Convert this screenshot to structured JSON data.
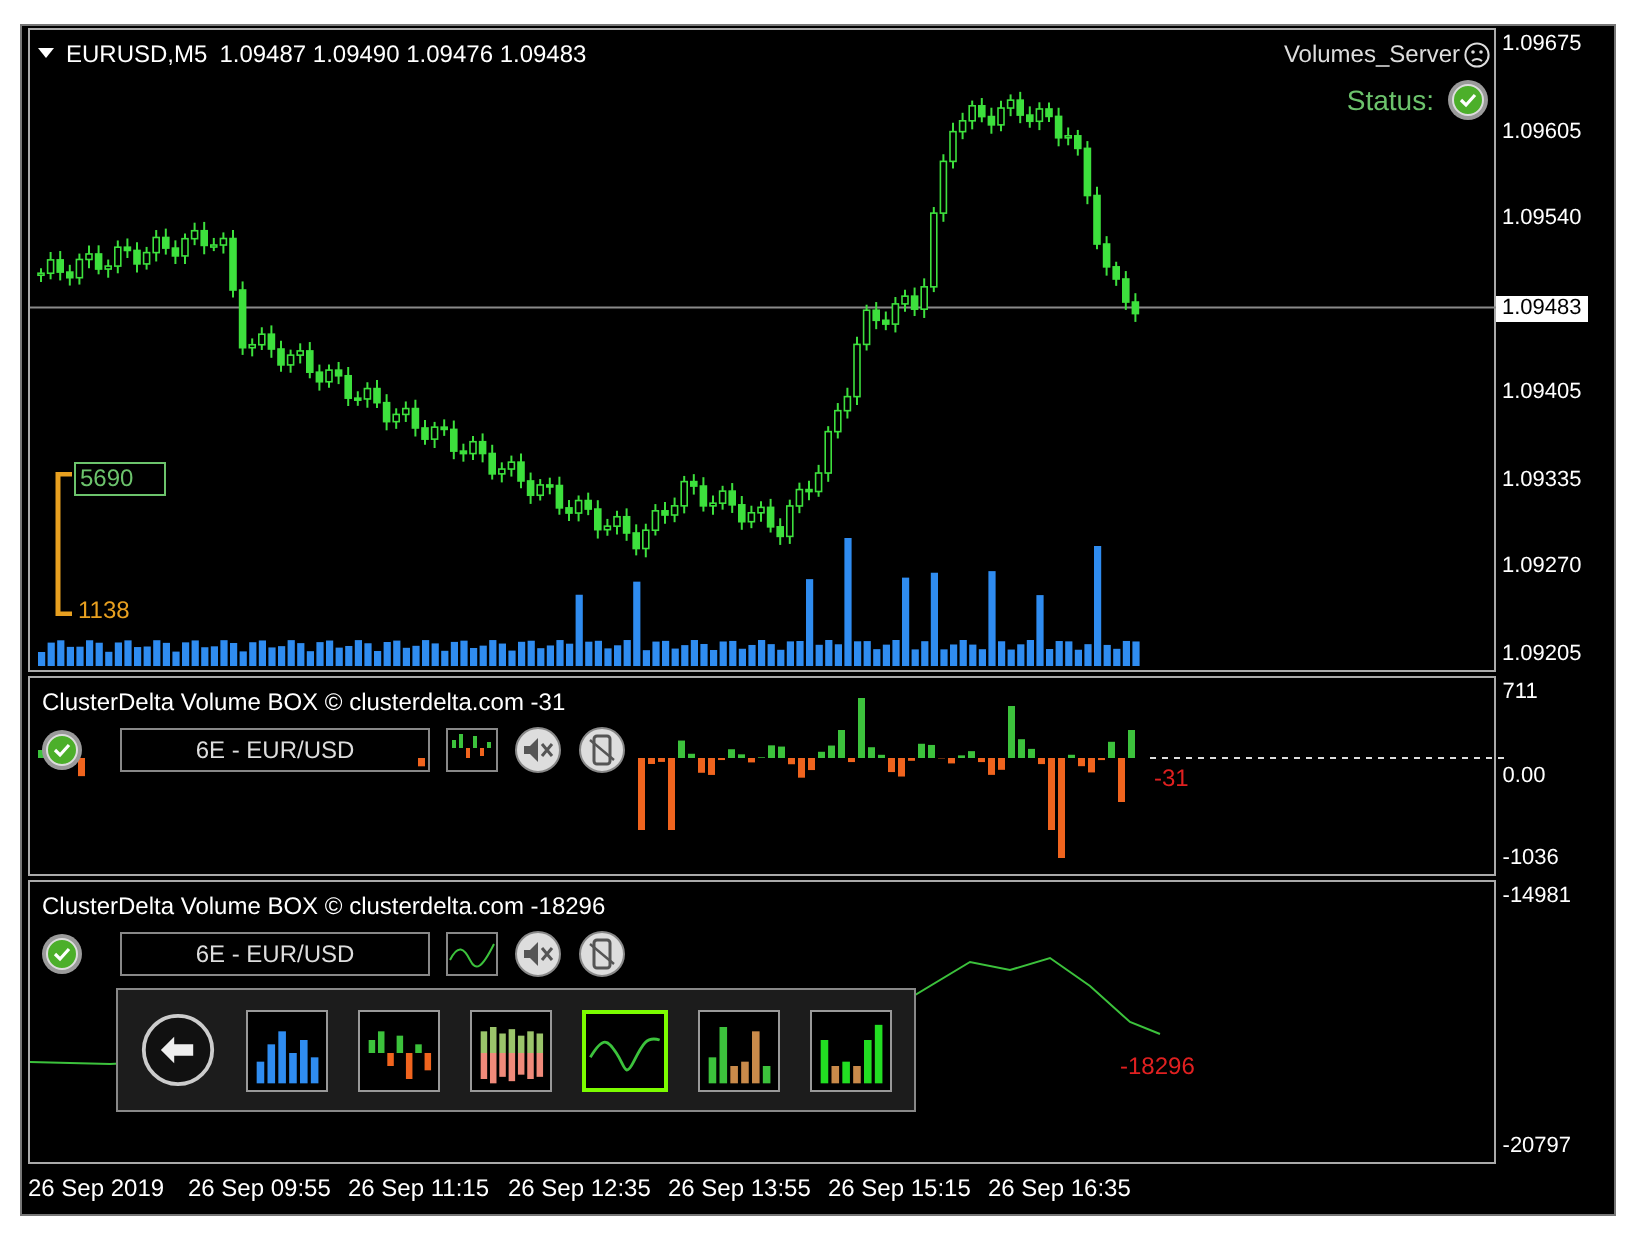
{
  "main_panel": {
    "symbol": "EURUSD,M5",
    "quote": "1.09487 1.09490 1.09476 1.09483",
    "server_label": "Volumes_Server",
    "status_label": "Status:",
    "status_ok": true,
    "price_axis": [
      "1.09675",
      "1.09605",
      "1.09540",
      "1.09405",
      "1.09335",
      "1.09270",
      "1.09205"
    ],
    "current_price": "1.09483",
    "volume_high": "5690",
    "volume_low": "1138"
  },
  "indicator_panels": [
    {
      "kind": "delta",
      "title": "ClusterDelta Volume BOX © clusterdelta.com -31",
      "connected": true,
      "instrument": "6E - EUR/USD",
      "last_value": "-31",
      "axis": [
        "711",
        "0.00",
        "-1036"
      ]
    },
    {
      "kind": "cumulative",
      "title": "ClusterDelta Volume BOX © clusterdelta.com -18296",
      "connected": true,
      "instrument": "6E - EUR/USD",
      "last_value": "-18296",
      "axis": [
        "-14981",
        "-20797"
      ],
      "modes": [
        {
          "kind": "volume",
          "selected": false
        },
        {
          "kind": "delta",
          "selected": false
        },
        {
          "kind": "split",
          "selected": false
        },
        {
          "kind": "cumulative",
          "selected": true
        },
        {
          "kind": "mixed",
          "selected": false
        },
        {
          "kind": "green-bars",
          "selected": false
        }
      ]
    }
  ],
  "time_axis": [
    "26 Sep 2019",
    "26 Sep 09:55",
    "26 Sep 11:15",
    "26 Sep 12:35",
    "26 Sep 13:55",
    "26 Sep 15:15",
    "26 Sep 16:35"
  ]
}
